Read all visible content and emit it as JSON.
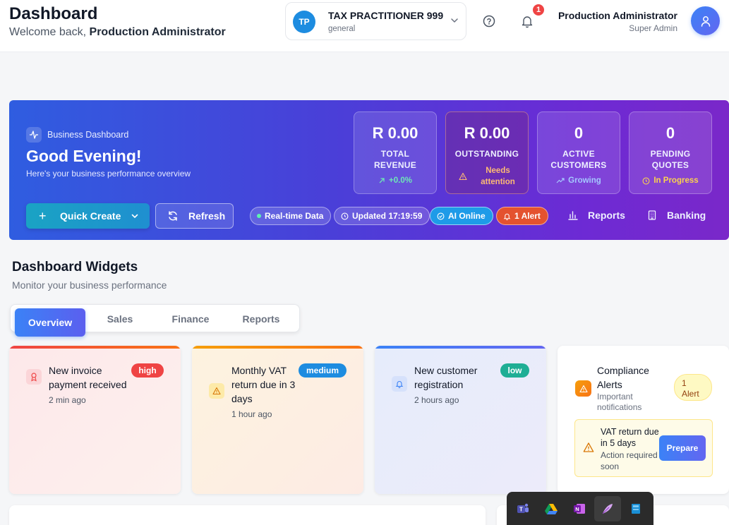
{
  "header": {
    "title": "Dashboard",
    "welcome_prefix": "Welcome back, ",
    "welcome_name": "Production Administrator"
  },
  "org": {
    "initials": "TP",
    "name": "TAX PRACTITIONER 999",
    "sub": "general"
  },
  "notifications": {
    "count": "1"
  },
  "user": {
    "name": "Production Administrator",
    "role": "Super Admin"
  },
  "hero": {
    "tag": "Business Dashboard",
    "greeting": "Good Evening!",
    "subtitle": "Here's your business performance overview",
    "stats": [
      {
        "value": "R 0.00",
        "label_1": "TOTAL",
        "label_2": "REVENUE",
        "foot": "+0.0%"
      },
      {
        "value": "R 0.00",
        "label_1": "OUTSTANDING",
        "label_2": "",
        "foot_1": "Needs",
        "foot_2": "attention"
      },
      {
        "value": "0",
        "label_1": "ACTIVE",
        "label_2": "CUSTOMERS",
        "foot": "Growing"
      },
      {
        "value": "0",
        "label_1": "PENDING",
        "label_2": "QUOTES",
        "foot": "In Progress"
      }
    ],
    "quick_create": "Quick Create",
    "refresh": "Refresh",
    "pills": {
      "realtime": "Real-time Data",
      "updated": "Updated 17:19:59",
      "ai": "AI Online",
      "alert": "1 Alert"
    },
    "links": {
      "reports": "Reports",
      "banking": "Banking"
    }
  },
  "widgets": {
    "title": "Dashboard Widgets",
    "subtitle": "Monitor your business performance",
    "tabs": [
      "Overview",
      "Sales",
      "Finance",
      "Reports"
    ]
  },
  "cards": [
    {
      "title": "New invoice payment received",
      "time": "2 min ago",
      "badge": "high",
      "badge_color": "#ef4444"
    },
    {
      "title": "Monthly VAT return due in 3 days",
      "time": "1 hour ago",
      "badge": "medium",
      "badge_color": "#1d8ce0"
    },
    {
      "title": "New customer registration",
      "time": "2 hours ago",
      "badge": "low",
      "badge_color": "#1fae95"
    }
  ],
  "compliance": {
    "title": "Compliance Alerts",
    "desc": "Important notifications",
    "badge_1": "1",
    "badge_2": "Alert",
    "item_title": "VAT return due in 5 days",
    "item_desc": "Action required soon",
    "button": "Prepare"
  },
  "taskbar": {
    "apps": [
      "teams-icon",
      "google-drive-icon",
      "onenote-icon",
      "feather-app-icon",
      "app-icon"
    ]
  }
}
